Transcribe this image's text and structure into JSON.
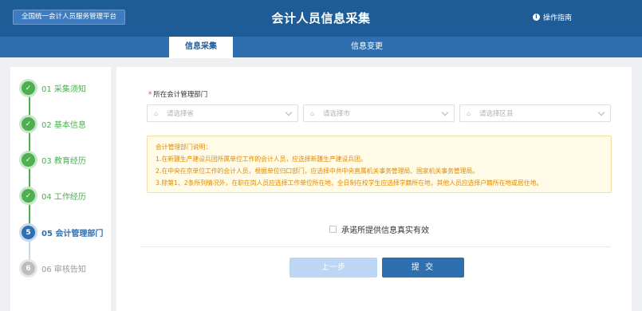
{
  "header": {
    "platform_label": "全国统一会计人员服务管理平台",
    "title": "会计人员信息采集",
    "help_label": "操作指南"
  },
  "tabs": [
    {
      "label": "信息采集",
      "active": true
    },
    {
      "label": "信息变更",
      "active": false
    }
  ],
  "steps": [
    {
      "num": "01",
      "label": "01 采集须知",
      "state": "done"
    },
    {
      "num": "02",
      "label": "02 基本信息",
      "state": "done"
    },
    {
      "num": "03",
      "label": "03 教育经历",
      "state": "done"
    },
    {
      "num": "04",
      "label": "04 工作经历",
      "state": "done"
    },
    {
      "num": "5",
      "label": "05 会计管理部门",
      "state": "current"
    },
    {
      "num": "6",
      "label": "06 审核告知",
      "state": "todo"
    }
  ],
  "form": {
    "field_label": "所在会计管理部门",
    "required_mark": "*",
    "selects": [
      {
        "placeholder": "请选择省"
      },
      {
        "placeholder": "请选择市"
      },
      {
        "placeholder": "请选择区县"
      }
    ]
  },
  "notice": {
    "title": "会计管理部门说明：",
    "lines": [
      "1.在新疆生产建设兵团所属单位工作的会计人员，应选择新疆生产建设兵团。",
      "2.在中央在京单位工作的会计人员，根据单位归口部门，应选择中共中央直属机关事务管理局、国家机关事务管理局。",
      "3.除第1、2条所列情况外，在职在岗人员应选择工作单位所在地，全日制在校学生应选择学籍所在地，其他人员应选择户籍所在地或居住地。"
    ]
  },
  "agreement": {
    "label": "承诺所提供信息真实有效",
    "checked": false
  },
  "buttons": {
    "prev": "上一步",
    "submit": "提 交"
  },
  "colors": {
    "header_bg": "#1e5c97",
    "tab_bg": "#2f6fb0",
    "done": "#4caf50",
    "notice_text": "#e08a00"
  }
}
